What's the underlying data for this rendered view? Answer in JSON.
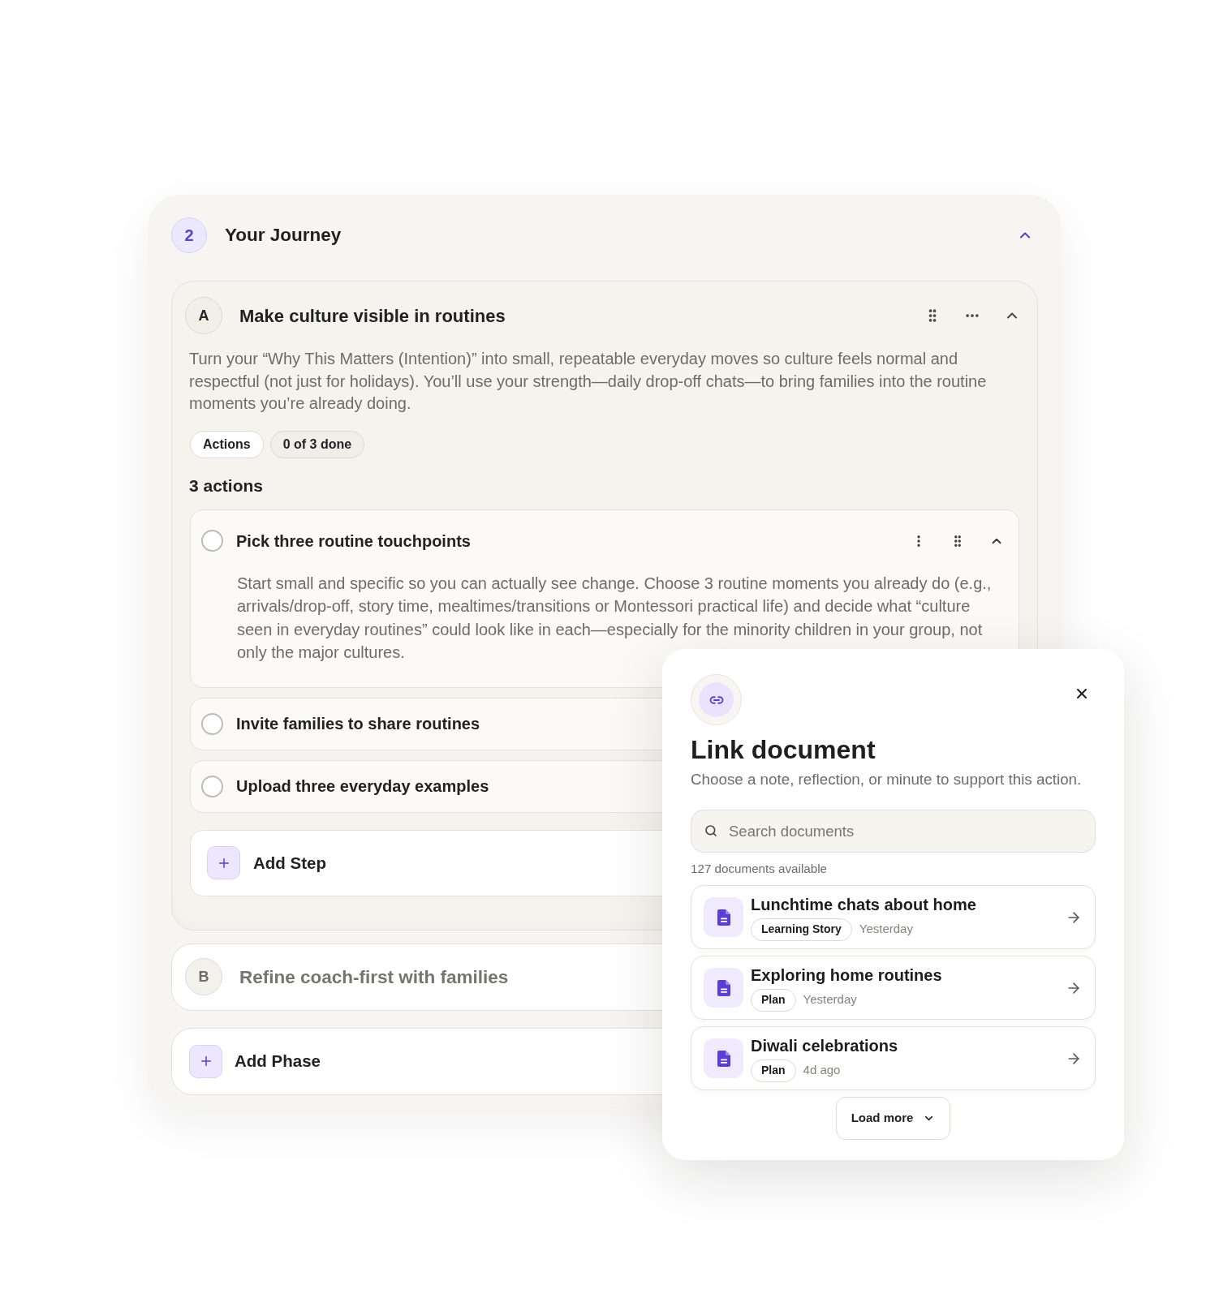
{
  "journey": {
    "number": "2",
    "title": "Your Journey",
    "expanded": true
  },
  "phases": [
    {
      "letter": "A",
      "title": "Make culture visible in routines",
      "expanded": true,
      "description": "Turn your “Why This Matters (Intention)” into small, repeatable everyday moves so culture feels normal and respectful (not just for holidays). You’ll use your strength—daily drop-off chats—to bring families into the routine moments you’re already doing.",
      "chips": [
        {
          "kind": "plain",
          "label": "Actions"
        },
        {
          "kind": "muted",
          "label": "0 of 3 done"
        }
      ],
      "actions_heading": "3 actions",
      "actions": [
        {
          "title": "Pick three routine touchpoints",
          "checked": false,
          "expanded": true,
          "description": "Start small and specific so you can actually see change. Choose 3 routine moments you already do (e.g., arrivals/drop-off, story time, mealtimes/transitions or Montessori practical life) and decide what “culture seen in everyday routines” could look like in each—especially for the minority children in your group, not only the major cultures."
        },
        {
          "title": "Invite families to share routines",
          "checked": false,
          "expanded": false
        },
        {
          "title": "Upload three everyday examples",
          "checked": false,
          "expanded": false
        }
      ],
      "add_step": "Add Step"
    },
    {
      "letter": "B",
      "title": "Refine coach-first with families",
      "expanded": false
    }
  ],
  "add_phase": "Add Phase",
  "dialog": {
    "title": "Link document",
    "subtitle": "Choose a note, reflection, or minute to support this action.",
    "search": {
      "placeholder": "Search documents"
    },
    "count": "127 documents available",
    "documents": [
      {
        "title": "Lunchtime chats about home",
        "tag": "Learning Story",
        "time": "Yesterday"
      },
      {
        "title": "Exploring home routines",
        "tag": "Plan",
        "time": "Yesterday"
      },
      {
        "title": "Diwali celebrations",
        "tag": "Plan",
        "time": "4d ago"
      }
    ],
    "load_more": "Load more"
  }
}
